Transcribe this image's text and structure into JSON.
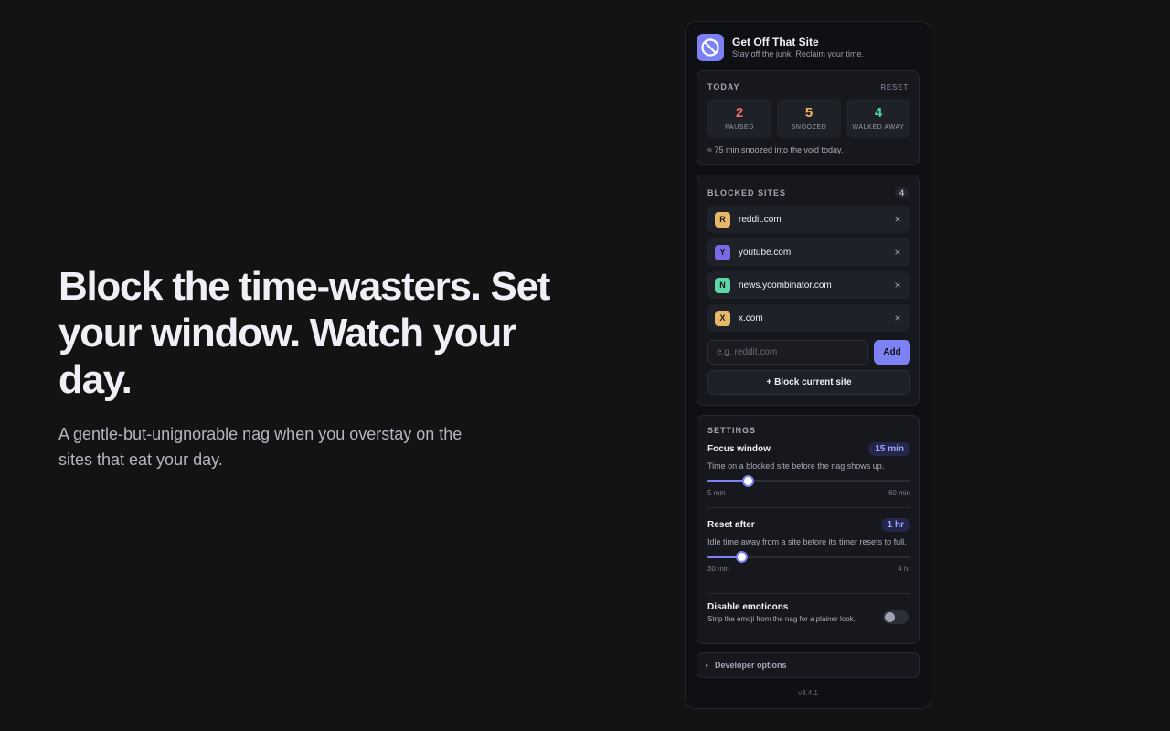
{
  "hero": {
    "headline": "Block the time-wasters. Set your window. Watch your day.",
    "subtext": "A gentle-but-unignorable nag when you overstay on the sites that eat your day."
  },
  "popup": {
    "brand": {
      "title": "Get Off That Site",
      "subtitle": "Stay off the junk. Reclaim your time.",
      "icon": "no-entry-icon",
      "accent": "#7c82f4"
    },
    "today": {
      "title": "TODAY",
      "reset_label": "RESET",
      "stats": [
        {
          "value": "2",
          "label": "PAUSED",
          "color": "#f06a6a"
        },
        {
          "value": "5",
          "label": "SNOOZED",
          "color": "#f0b75a"
        },
        {
          "value": "4",
          "label": "WALKED AWAY",
          "color": "#4fd69c"
        }
      ],
      "note": "≈ 75 min snoozed into the void today."
    },
    "blocked": {
      "title": "BLOCKED SITES",
      "count": "4",
      "sites": [
        {
          "letter": "R",
          "name": "reddit.com",
          "color": "#e7b86a"
        },
        {
          "letter": "Y",
          "name": "youtube.com",
          "color": "#7c69e6"
        },
        {
          "letter": "N",
          "name": "news.ycombinator.com",
          "color": "#5fd6a8"
        },
        {
          "letter": "X",
          "name": "x.com",
          "color": "#e7b86a"
        }
      ],
      "remove_glyph": "×",
      "input_placeholder": "e.g. reddit.com",
      "add_label": "Add",
      "block_current_label": "+ Block current site"
    },
    "settings": {
      "title": "SETTINGS",
      "focus": {
        "title": "Focus window",
        "value": "15 min",
        "desc": "Time on a blocked site before the nag shows up.",
        "min_label": "5 min",
        "max_label": "60 min",
        "fraction": 0.2
      },
      "reset": {
        "title": "Reset after",
        "value": "1 hr",
        "desc": "Idle time away from a site before its timer resets to full.",
        "min_label": "30 min",
        "max_label": "4 hr",
        "fraction": 0.167
      },
      "emoticons": {
        "title": "Disable emoticons",
        "desc": "Strip the emoji from the nag for a plainer look.",
        "enabled": false
      }
    },
    "developer": {
      "caret": "▸",
      "label": "Developer options"
    },
    "version": "v3.4.1"
  }
}
